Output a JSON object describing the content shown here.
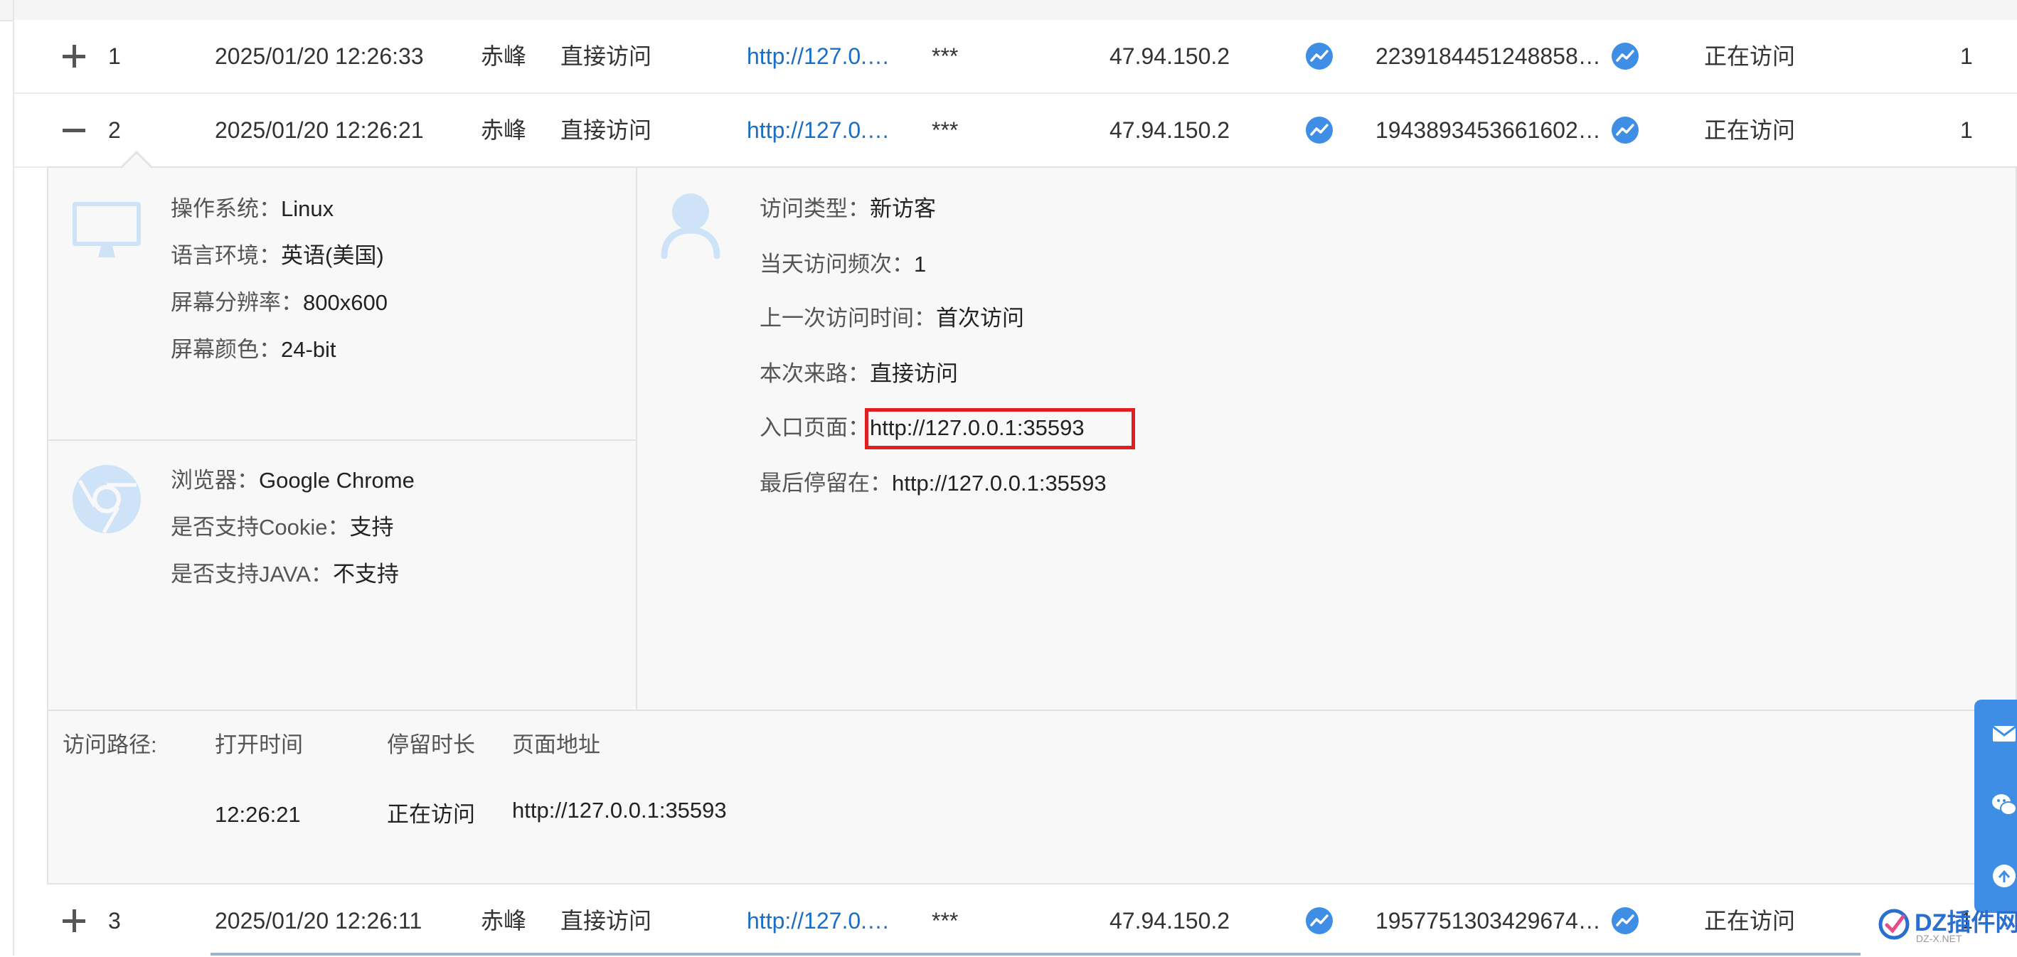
{
  "rows": [
    {
      "toggle": "+",
      "index": "1",
      "time": "2025/01/20 12:26:33",
      "city": "赤峰",
      "source": "直接访问",
      "url": "http://127.0.…",
      "keyword": "***",
      "ip": "47.94.150.2",
      "visitor_id": "2239184451248858…",
      "status": "正在访问",
      "count": "1"
    },
    {
      "toggle": "−",
      "index": "2",
      "time": "2025/01/20 12:26:21",
      "city": "赤峰",
      "source": "直接访问",
      "url": "http://127.0.…",
      "keyword": "***",
      "ip": "47.94.150.2",
      "visitor_id": "1943893453661602…",
      "status": "正在访问",
      "count": "1"
    },
    {
      "toggle": "+",
      "index": "3",
      "time": "2025/01/20 12:26:11",
      "city": "赤峰",
      "source": "直接访问",
      "url": "http://127.0.…",
      "keyword": "***",
      "ip": "47.94.150.2",
      "visitor_id": "1957751303429674…",
      "status": "正在访问",
      "count": "1"
    }
  ],
  "detail": {
    "system": [
      {
        "label": "操作系统：",
        "value": "Linux"
      },
      {
        "label": "语言环境：",
        "value": "英语(美国)"
      },
      {
        "label": "屏幕分辨率：",
        "value": "800x600"
      },
      {
        "label": "屏幕颜色：",
        "value": "24-bit"
      }
    ],
    "browser": [
      {
        "label": "浏览器：",
        "value": "Google Chrome"
      },
      {
        "label": "是否支持Cookie：",
        "value": "支持"
      },
      {
        "label": "是否支持JAVA：",
        "value": "不支持"
      }
    ],
    "visit": [
      {
        "label": "访问类型：",
        "value": "新访客"
      },
      {
        "label": "当天访问频次：",
        "value": "1"
      },
      {
        "label": "上一次访问时间：",
        "value": "首次访问"
      },
      {
        "label": "本次来路：",
        "value": "直接访问"
      },
      {
        "label": "入口页面：",
        "value": "http://127.0.0.1:35593"
      },
      {
        "label": "最后停留在：",
        "value": "http://127.0.0.1:35593"
      }
    ],
    "path": {
      "label": "访问路径:",
      "headers": [
        "打开时间",
        "停留时长",
        "页面地址"
      ],
      "rows": [
        {
          "open_time": "12:26:21",
          "duration": "正在访问",
          "page": "http://127.0.0.1:35593"
        }
      ]
    }
  },
  "icons": {
    "monitor": "monitor-icon",
    "chrome": "chrome-icon",
    "user": "user-icon",
    "trend": "trend-icon",
    "mail": "mail-icon",
    "wechat": "wechat-icon",
    "top": "arrow-up-icon"
  },
  "watermark": {
    "text": "DZ插件网",
    "sub": "DZ-X.NET"
  },
  "colors": {
    "link": "#1a6fc4",
    "icon_blue": "#3e8ee6",
    "highlight": "#e02020",
    "icon_light": "#cfe3f8"
  }
}
